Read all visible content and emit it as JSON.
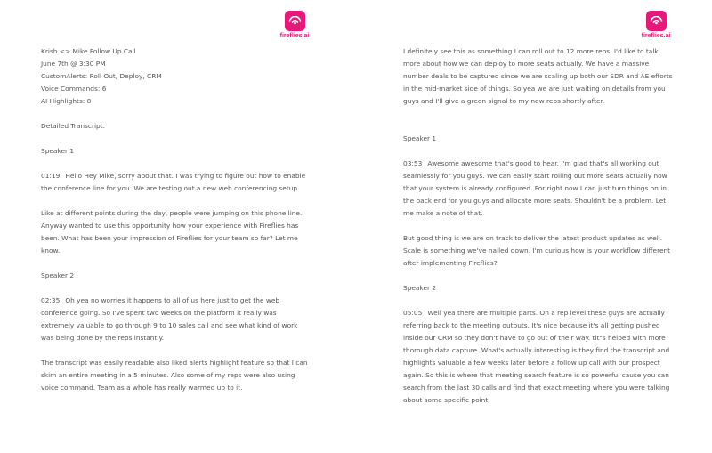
{
  "logo": {
    "brand": "fireflies.ai"
  },
  "header": {
    "title": "Krish <> Mike Follow Up Call",
    "date": "June 7th @ 3:30 PM",
    "custom_alerts": "CustomAlerts: Roll Out, Deploy, CRM",
    "voice_commands": "Voice Commands: 6",
    "ai_highlights": "AI Highlights: 8",
    "detailed_transcript": "Detailed Transcript:"
  },
  "left": {
    "speaker1": "Speaker 1",
    "t1": "01:19",
    "p1": "Hello Hey Mike, sorry about that. I was trying to figure out how to enable the conference line for you. We are testing out a new web conferencing setup.",
    "p2": "Like at different points during the day, people were jumping on this phone line. Anyway wanted to use this opportunity how your experience with Fireflies has been. What has been your impression of Fireflies for your team so far? Let me know.",
    "speaker2": "Speaker 2",
    "t2": "02:35",
    "p3": "Oh yea no worries it happens to all of us here just to get the web conference going. So I've spent two weeks on the platform  it really was extremely valuable to go through 9 to 10  sales call and see what kind of work was being done by the reps instantly.",
    "p4": "The transcript was easily readable also liked alerts highlight feature so that I can skim an entire meeting in a 5 minutes. Also some of my reps were also using voice command. Team as a whole has really warmed up to it."
  },
  "right": {
    "p0": "I definitely see this as something I can roll out to 12 more reps. I'd like to talk more about how we can deploy to more seats actually. We have a massive number deals to be captured since we are scaling up both our SDR and AE efforts in the mid-market side of things. So yea we are just waiting on details from you guys and I'll give a green signal to my new reps shortly after.",
    "speaker1": "Speaker 1",
    "t3": "03:53",
    "p1": "Awesome awesome that's good to hear. I'm glad that's all working out seamlessly for you guys. We can easily start rolling out more seats actually now that your system is already configured. For right now I can just turn things on in the back end for you guys and allocate more seats. Shouldn't be a problem. Let me make a note of that.",
    "p2": "But good thing is we are on track to deliver the latest product updates as well. Scale is something we've nailed down. I'm curious how is your workflow different after implementing Fireflies?",
    "speaker2": "Speaker 2",
    "t4": "05:05",
    "p3": "Well yea there are multiple parts. On a rep level these guys are actually referring back to the meeting outputs. It's nice because it's all getting pushed inside our CRM so they don't have to go out of their way. tit\"s helped with more thorough data capture. What's actually interesting is they find the transcript and highlights valuable a few weeks later before a follow up call with our prospect again. So this is where that meeting search feature is so powerful cause you can search from the last 30 calls and find that exact meeting where you were talking about some specific point."
  }
}
